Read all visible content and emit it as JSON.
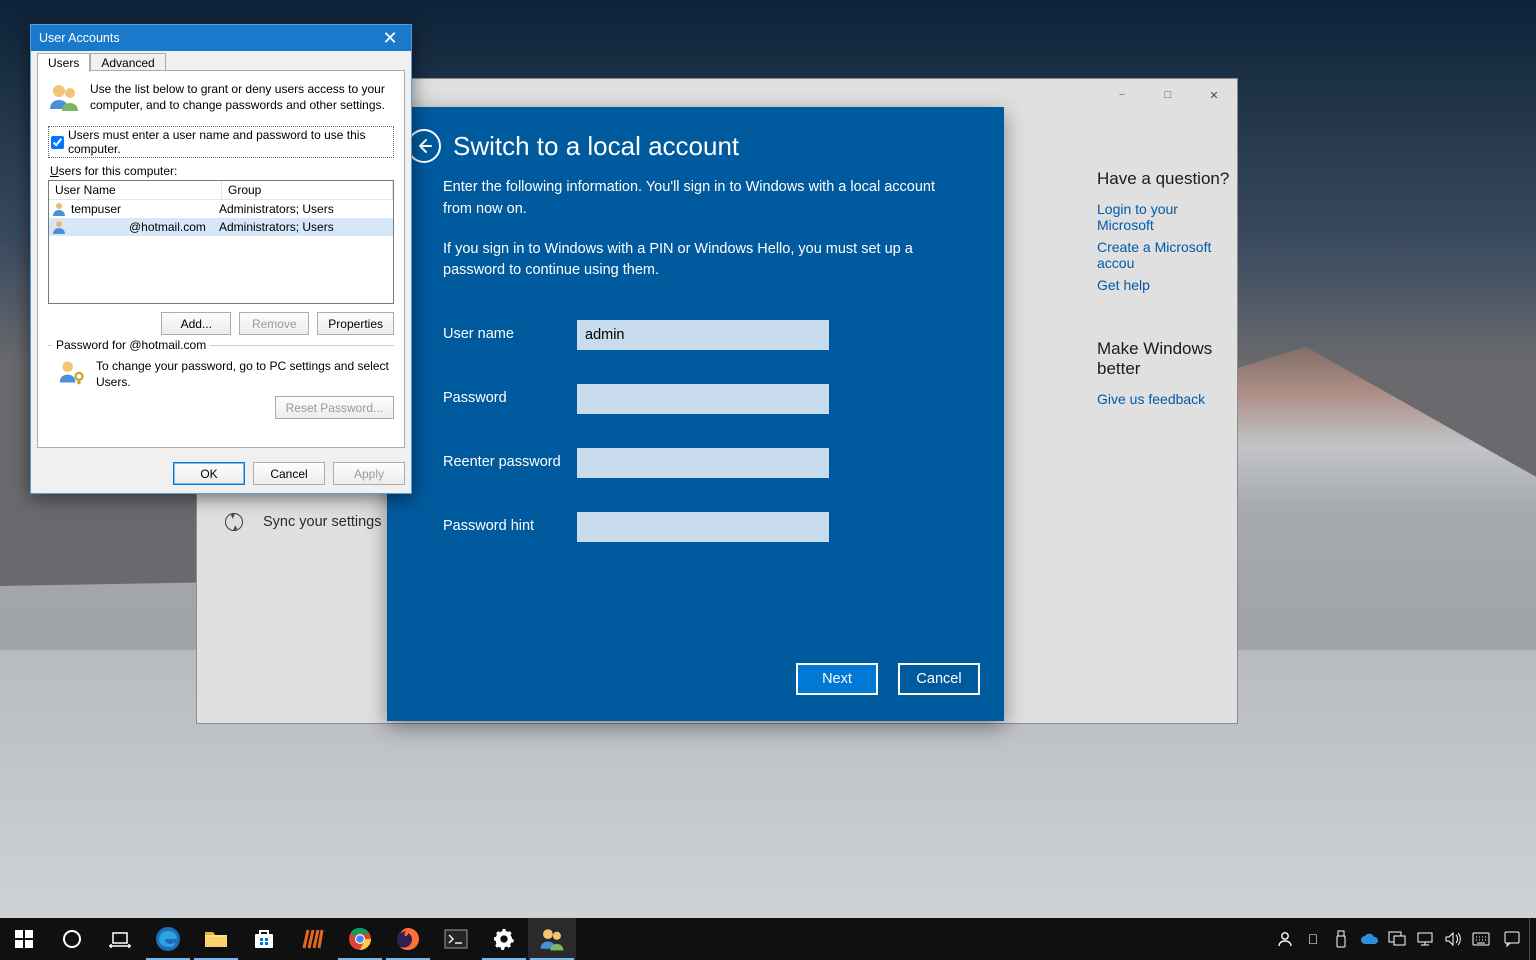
{
  "settings": {
    "sidebar": {
      "sync": "Sync your settings"
    },
    "right": {
      "question": "Have a question?",
      "login_ms": "Login to your Microsoft",
      "create_ms": "Create a Microsoft accou",
      "get_help": "Get help",
      "better": "Make Windows better",
      "feedback": "Give us feedback"
    }
  },
  "switch_panel": {
    "title": "Switch to a local account",
    "p1": "Enter the following information. You'll sign in to Windows with a local account from now on.",
    "p2": "If you sign in to Windows with a PIN or Windows Hello, you must set up a password to continue using them.",
    "labels": {
      "username": "User name",
      "password": "Password",
      "reenter": "Reenter password",
      "hint": "Password hint"
    },
    "values": {
      "username": "admin"
    },
    "buttons": {
      "next": "Next",
      "cancel": "Cancel"
    }
  },
  "user_accounts": {
    "title": "User Accounts",
    "tabs": {
      "users": "Users",
      "advanced": "Advanced"
    },
    "intro": "Use the list below to grant or deny users access to your computer, and to change passwords and other settings.",
    "check_label": "Users must enter a user name and password to use this computer.",
    "users_for_label": "Users for this computer:",
    "columns": {
      "name": "User Name",
      "group": "Group"
    },
    "rows": [
      {
        "name": "tempuser",
        "group": "Administrators; Users",
        "selected": false
      },
      {
        "name": "@hotmail.com",
        "group": "Administrators; Users",
        "selected": true,
        "indent": true
      }
    ],
    "buttons": {
      "add": "Add...",
      "remove": "Remove",
      "properties": "Properties",
      "reset": "Reset Password..."
    },
    "pw_section_title": "Password for              @hotmail.com",
    "pw_text": "To change your password, go to PC settings and select Users.",
    "footer": {
      "ok": "OK",
      "cancel": "Cancel",
      "apply": "Apply"
    }
  }
}
